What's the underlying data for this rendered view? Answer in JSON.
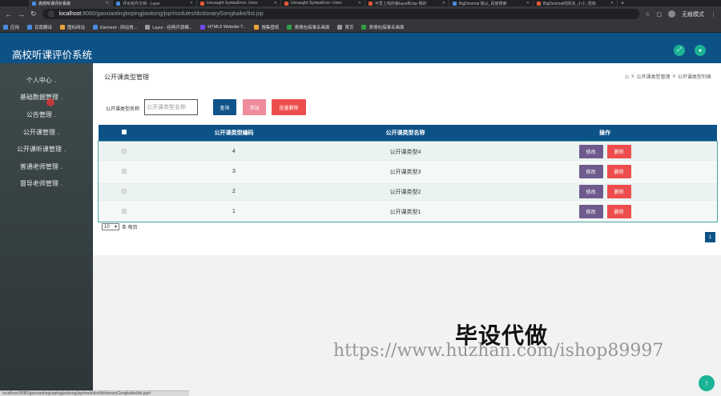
{
  "browser": {
    "tabs": [
      {
        "title": "高校听课评价系统",
        "active": true
      },
      {
        "title": "评论组件文档 - Layui",
        "active": false
      },
      {
        "title": "Uncaught SyntaxError: Unex",
        "active": false
      },
      {
        "title": "Uncaught SyntaxError: Unex",
        "active": false
      },
      {
        "title": "可爱上啦的板layui和Jsp 我的",
        "active": false
      },
      {
        "title": "BigDecimal 除以_百度搜索",
        "active": false
      },
      {
        "title": "BigDecimal的除法_小小_轻炼",
        "active": false
      }
    ],
    "new_tab": "+",
    "url_host": "localhost",
    "url_path": ":8080/gaoxiaotingkepingjiaxitong/jsp/modules/dictionaryGongkaike/list.jsp",
    "incognito_label": "无痕模式",
    "bookmarks": [
      {
        "label": "应用",
        "icon": "apps-icon"
      },
      {
        "label": "百度翻译",
        "icon": "translate-icon"
      },
      {
        "label": "图标网站",
        "icon": "image-icon"
      },
      {
        "label": "Element - 网站快...",
        "icon": "element-icon"
      },
      {
        "label": "Layui - 经典开源模...",
        "icon": "layui-icon"
      },
      {
        "label": "HTML5 Website T...",
        "icon": "html5-icon"
      },
      {
        "label": "搜集壁纸",
        "icon": "wallpaper-icon"
      },
      {
        "label": "表情包搞事名画面",
        "icon": "emoji-icon"
      },
      {
        "label": "首页",
        "icon": "home-icon"
      },
      {
        "label": "表情包搞事名画面",
        "icon": "emoji-icon"
      }
    ],
    "status_url": "localhost:8080/gaoxiaotingkepingjiaxitong/jsp/modules/dictionaryGongkaike/list.jsp#"
  },
  "app": {
    "title": "高校听课评价系统",
    "header_color": "#0d5287",
    "accent_color": "#1ab394"
  },
  "sidebar": {
    "items": [
      {
        "label": "个人中心",
        "caret": "⌄"
      },
      {
        "label": "基础数据管理",
        "caret": "⌄"
      },
      {
        "label": "公告管理",
        "caret": "⌄"
      },
      {
        "label": "公开课管理",
        "caret": "⌄"
      },
      {
        "label": "公开课听课管理",
        "caret": "⌄"
      },
      {
        "label": "普通老师管理",
        "caret": "⌄"
      },
      {
        "label": "督导老师管理",
        "caret": "⌄"
      }
    ]
  },
  "page": {
    "title": "公开课类型管理",
    "breadcrumb": [
      "公开课类型管理",
      "公开课类型列表"
    ],
    "breadcrumb_sep": "≡"
  },
  "search": {
    "label": "公开课类型名称",
    "placeholder": "公开课类型名称",
    "search_btn": "查询",
    "add_btn": "添加",
    "batch_delete_btn": "批量删除"
  },
  "table": {
    "headers": [
      "",
      "公开课类型编码",
      "公开课类型名称",
      "操作"
    ],
    "rows": [
      {
        "code": "4",
        "name": "公开课类型4"
      },
      {
        "code": "3",
        "name": "公开课类型3"
      },
      {
        "code": "2",
        "name": "公开课类型2"
      },
      {
        "code": "1",
        "name": "公开课类型1"
      }
    ],
    "edit_label": "修改",
    "delete_label": "删除"
  },
  "pagination": {
    "page_size": "10",
    "per_page_label": "条 每页",
    "current_page": "1"
  },
  "overlay": {
    "watermark": "毕设代做",
    "watermark_url": "https://www.huzhan.com/ishop89997",
    "back_top": "↑"
  }
}
